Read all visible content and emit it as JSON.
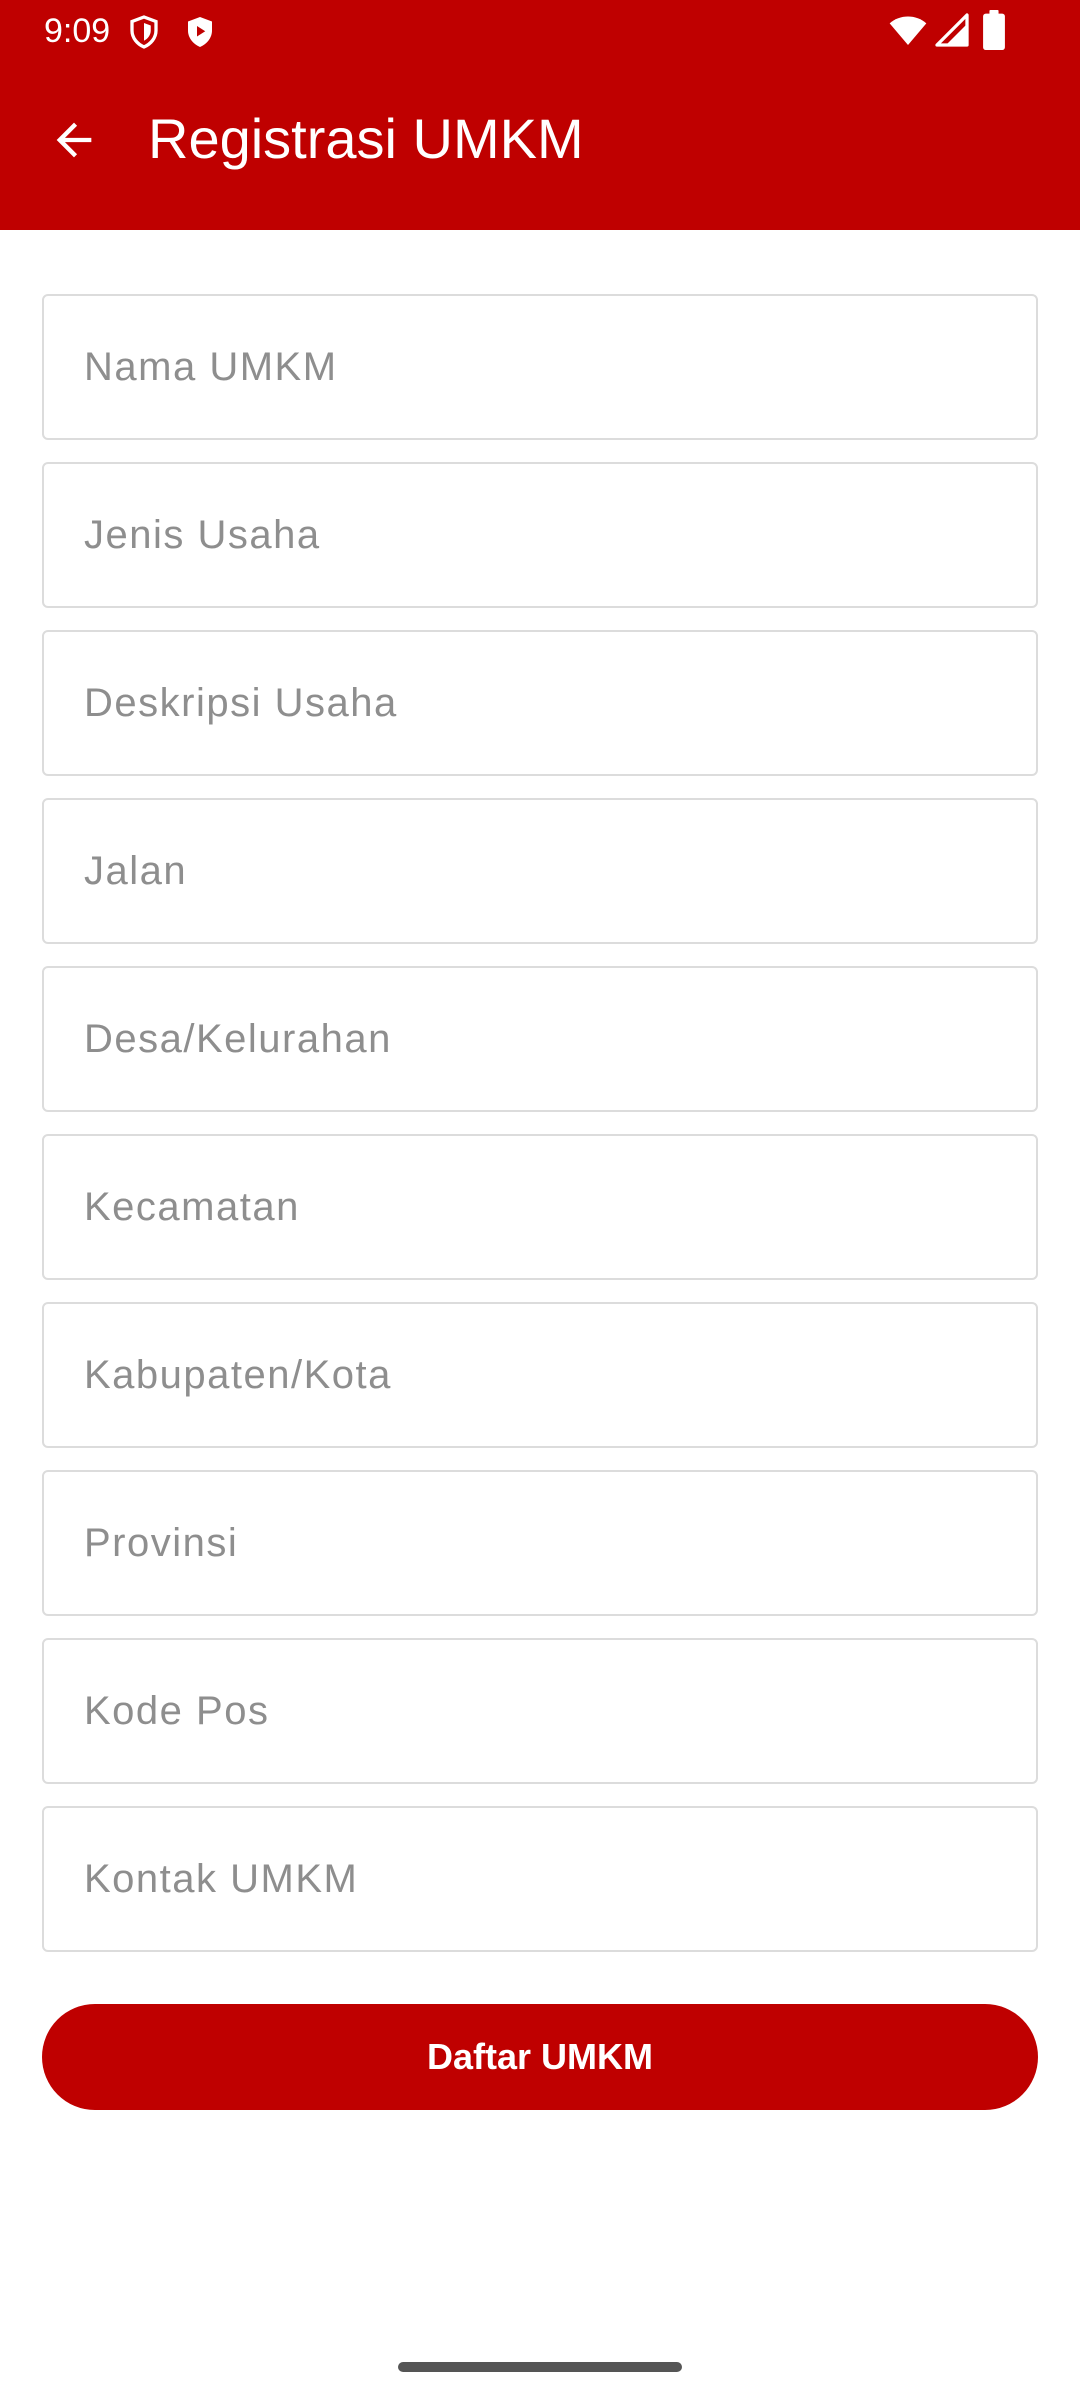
{
  "status_bar": {
    "time": "9:09",
    "left_icons": [
      "vpn-shield-icon",
      "play-protect-icon"
    ],
    "right_icons": [
      "wifi-icon",
      "cell-signal-icon",
      "battery-icon"
    ]
  },
  "app_bar": {
    "title": "Registrasi UMKM",
    "back_icon": "arrow-back-icon",
    "color": "#BF0000"
  },
  "form": {
    "fields": [
      {
        "name": "nama-umkm",
        "value": "",
        "placeholder": "Nama UMKM"
      },
      {
        "name": "jenis-usaha",
        "value": "",
        "placeholder": "Jenis Usaha"
      },
      {
        "name": "deskripsi-usaha",
        "value": "",
        "placeholder": "Deskripsi Usaha"
      },
      {
        "name": "jalan",
        "value": "",
        "placeholder": "Jalan"
      },
      {
        "name": "desa-kelurahan",
        "value": "",
        "placeholder": "Desa/Kelurahan"
      },
      {
        "name": "kecamatan",
        "value": "",
        "placeholder": "Kecamatan"
      },
      {
        "name": "kabupaten-kota",
        "value": "",
        "placeholder": "Kabupaten/Kota"
      },
      {
        "name": "provinsi",
        "value": "",
        "placeholder": "Provinsi"
      },
      {
        "name": "kode-pos",
        "value": "",
        "placeholder": "Kode Pos"
      },
      {
        "name": "kontak-umkm",
        "value": "",
        "placeholder": "Kontak UMKM"
      }
    ],
    "submit_label": "Daftar UMKM"
  }
}
